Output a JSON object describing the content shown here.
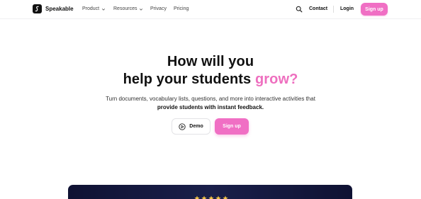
{
  "nav": {
    "brand": "Speakable",
    "links": [
      {
        "label": "Product",
        "dropdown": true
      },
      {
        "label": "Resources",
        "dropdown": true
      },
      {
        "label": "Privacy",
        "dropdown": false
      },
      {
        "label": "Pricing",
        "dropdown": false
      }
    ],
    "search_icon": "search-icon",
    "contact": "Contact",
    "login": "Login",
    "signup": "Sign up"
  },
  "hero": {
    "title_line1": "How will you",
    "title_line2_prefix": "help your students ",
    "title_line2_accent": "grow?",
    "subtitle_line1": "Turn documents, vocabulary lists, questions, and more into interactive activities that",
    "subtitle_line2": "provide students with instant feedback.",
    "demo_button": "Demo",
    "signup_button": "Sign up"
  },
  "colors": {
    "accent": "#f06fc4",
    "accent_text": "#ee6fbf",
    "panel": "#141838",
    "star": "#f5c542"
  },
  "rating": {
    "stars": 5
  }
}
